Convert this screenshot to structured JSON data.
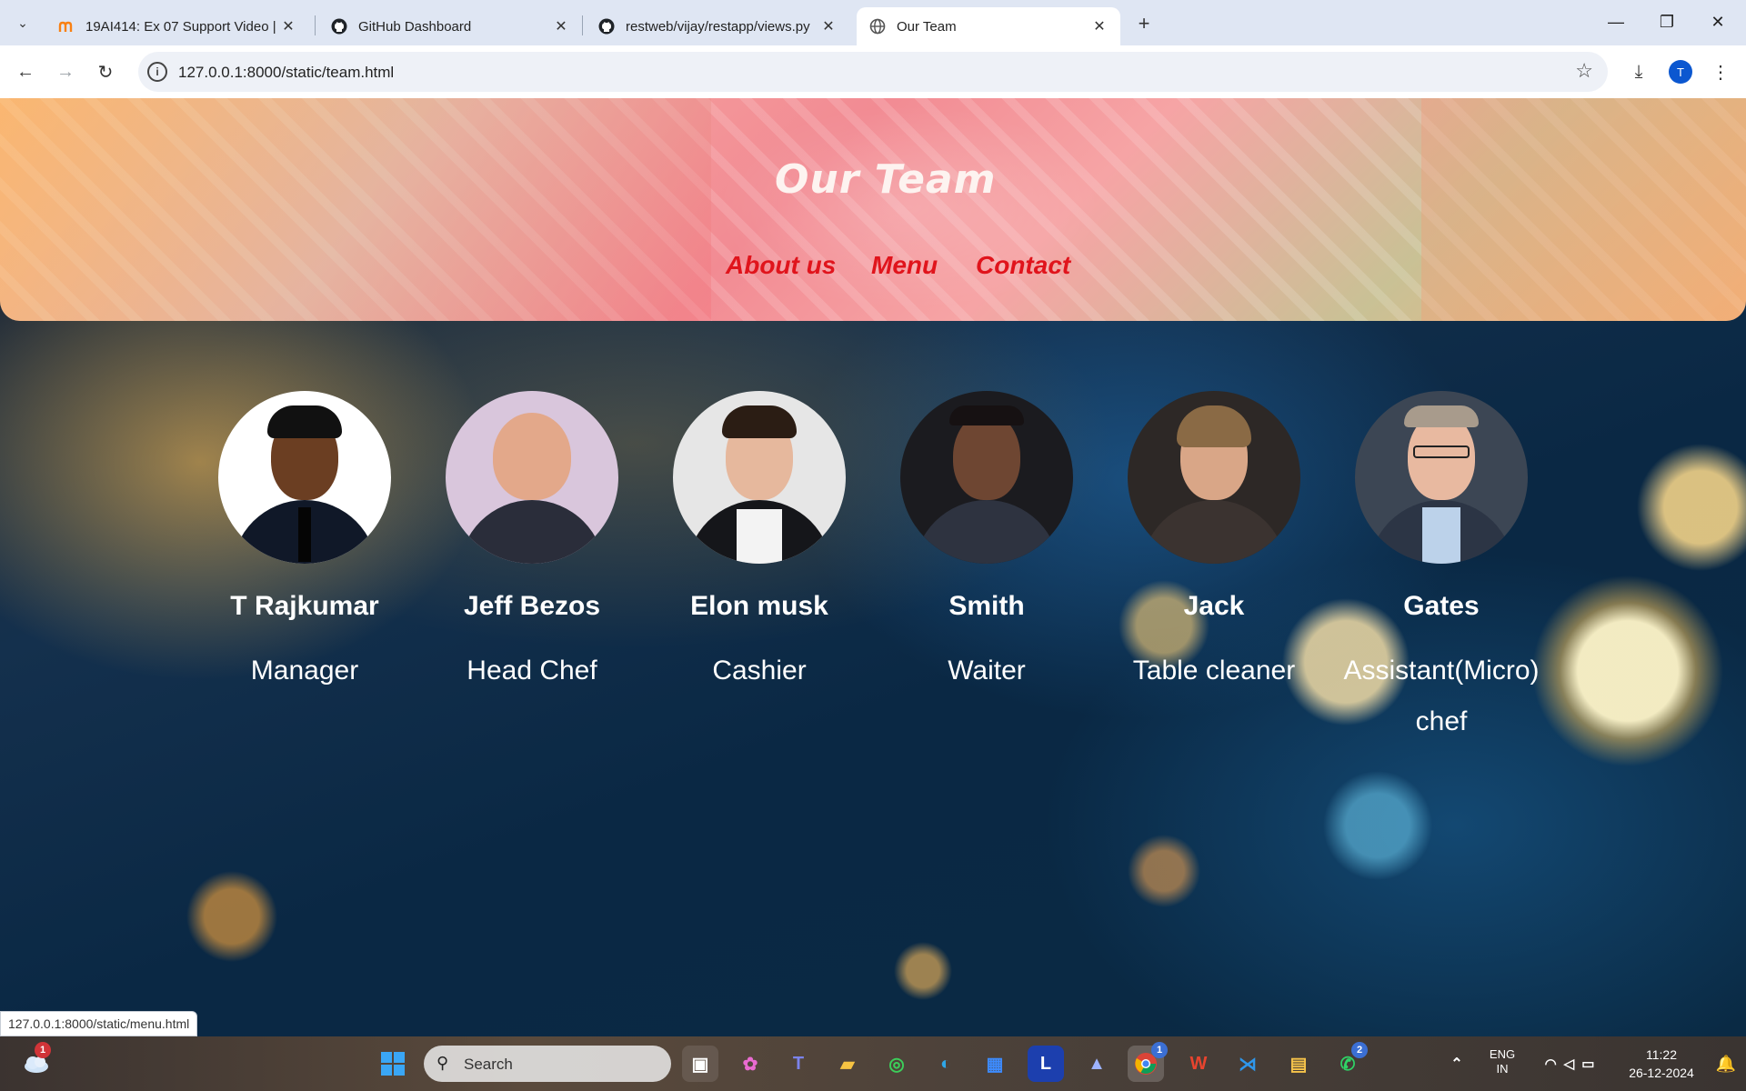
{
  "browser": {
    "tabs": [
      {
        "title": "19AI414: Ex 07 Support Video |",
        "icon": "moodle-icon"
      },
      {
        "title": "GitHub Dashboard",
        "icon": "github-icon"
      },
      {
        "title": "restweb/vijay/restapp/views.py",
        "icon": "github-icon"
      },
      {
        "title": "Our Team",
        "icon": "globe-icon",
        "active": true
      }
    ],
    "url": "127.0.0.1:8000/static/team.html",
    "profile_initial": "T",
    "status_url": "127.0.0.1:8000/static/menu.html"
  },
  "page": {
    "title": "Our Team",
    "nav": [
      "About us",
      "Menu",
      "Contact"
    ],
    "nav_color": "#e0141c",
    "members": [
      {
        "name": "T Rajkumar",
        "role": "Manager"
      },
      {
        "name": "Jeff Bezos",
        "role": "Head Chef"
      },
      {
        "name": "Elon musk",
        "role": "Cashier"
      },
      {
        "name": "Smith",
        "role": "Waiter"
      },
      {
        "name": "Jack",
        "role": "Table cleaner"
      },
      {
        "name": "Gates",
        "role": "Assistant(Micro) chef"
      }
    ]
  },
  "taskbar": {
    "search_placeholder": "Search",
    "weather_badge": "1",
    "chrome_badge": "1",
    "whatsapp_badge": "2",
    "language": "ENG",
    "region": "IN",
    "time": "11:22",
    "date": "26-12-2024"
  }
}
